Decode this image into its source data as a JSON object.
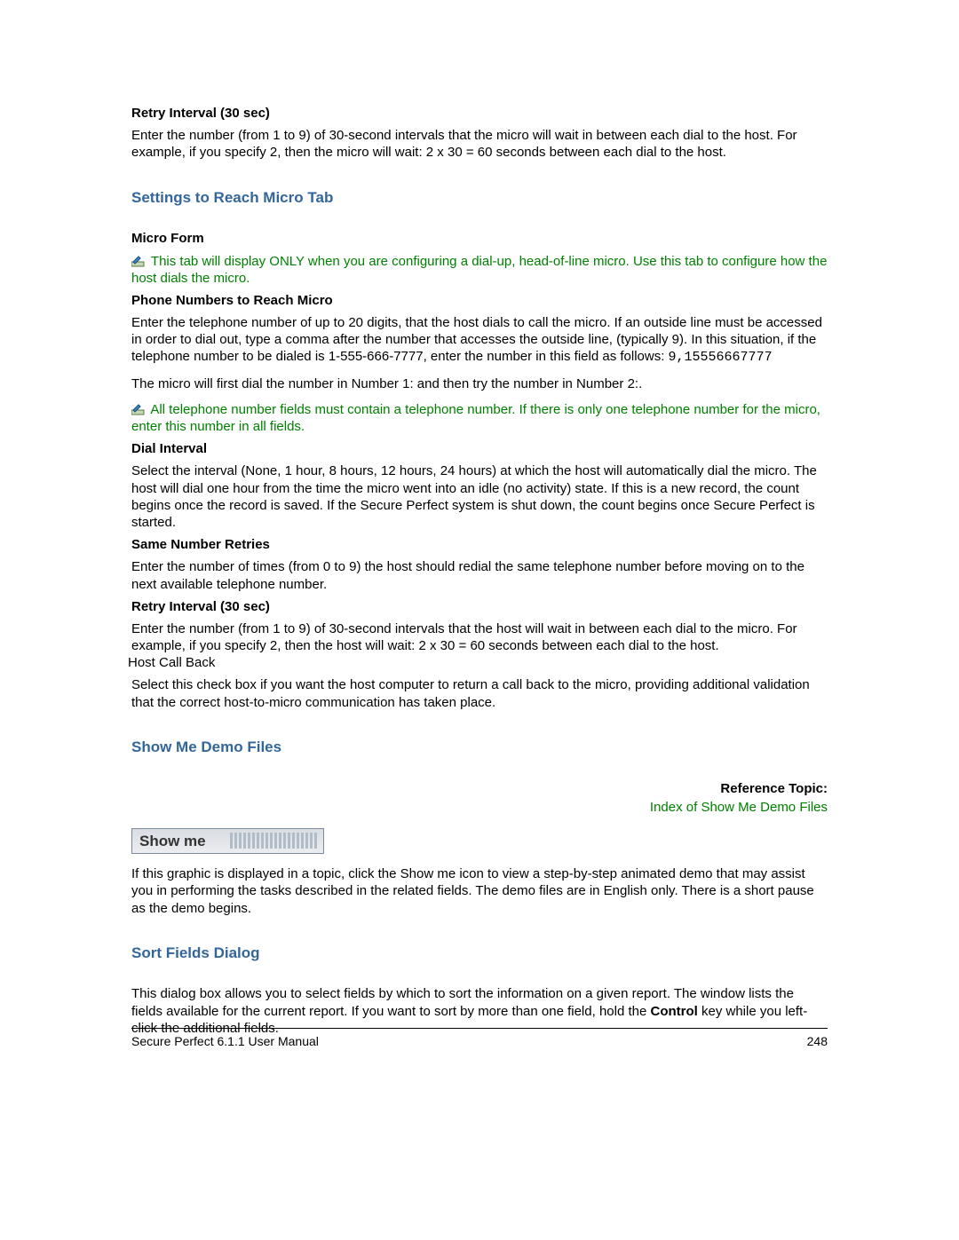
{
  "retry_interval_host": {
    "title": "Retry Interval (30 sec)",
    "body": "Enter the number (from 1 to 9) of 30-second intervals that the micro will wait in between each dial to the host. For example, if you specify 2, then the micro will wait: 2 x 30 = 60 seconds between each dial to the host."
  },
  "section_settings": {
    "title": "Settings to Reach Micro Tab",
    "micro_form_title": "Micro Form",
    "note1": "This tab will display ONLY  when you are configuring a dial-up, head-of-line micro. Use this tab to configure how the host dials the micro.",
    "phone_title": "Phone Numbers to Reach Micro",
    "phone_body_a": "Enter the telephone number of up to 20 digits, that the host dials to call the micro. If an outside line must be accessed in order to dial out, type a comma after the number that accesses the outside line, (typically 9). In this situation, if the telephone number to be dialed is 1-555-666-7777, enter the number in this field as follows: ",
    "phone_body_mono": "9,15556667777",
    "phone_body_b": "The micro will first dial the number in Number 1: and then try the number in Number 2:.",
    "note2": "All telephone number fields must contain a telephone number. If there is only one telephone number for the micro, enter this number in all fields.",
    "dial_interval_title": "Dial Interval",
    "dial_interval_body": "Select the interval (None, 1 hour, 8 hours, 12 hours, 24 hours) at which the host will automatically dial the micro. The host will dial one hour from the time the micro went into an idle (no activity) state. If this is a new record, the count begins once the record is saved. If the Secure Perfect system is shut down, the count begins once Secure Perfect is started.",
    "same_retries_title": "Same Number Retries",
    "same_retries_body": "Enter the number of times (from 0 to 9) the host should redial the same telephone number before moving on to the next available telephone number.",
    "retry_interval_micro_title": "Retry Interval (30 sec)",
    "retry_interval_micro_body": "Enter the number (from 1 to 9) of 30-second intervals that the host will wait in between each dial to the micro. For example, if you specify 2, then the host will wait: 2 x 30 = 60 seconds between each dial to the host.",
    "host_callback_label": "Host Call Back",
    "host_callback_body": "Select this check box if you want the host computer to return a call back to the micro, providing additional validation that the correct host-to-micro communication has taken place."
  },
  "section_showme": {
    "title": "Show Me Demo Files",
    "ref_label": "Reference Topic",
    "ref_link": "Index of Show Me Demo Files",
    "graphic_label": "Show me",
    "body": "If this graphic is displayed in a topic, click the Show me icon to view a step-by-step animated demo that may assist you in performing the tasks described in the related fields. The demo files are in English only. There is a short pause as the demo begins."
  },
  "section_sort": {
    "title": "Sort Fields Dialog",
    "body_a": "This dialog box allows you to select fields by which to sort the information on a given report. The window lists the fields available for the current report. If you want to sort by more than one field, hold the ",
    "body_bold": "Control",
    "body_b": " key while you left-click the additional fields."
  },
  "footer": {
    "left": "Secure Perfect 6.1.1 User Manual",
    "right": "248"
  }
}
